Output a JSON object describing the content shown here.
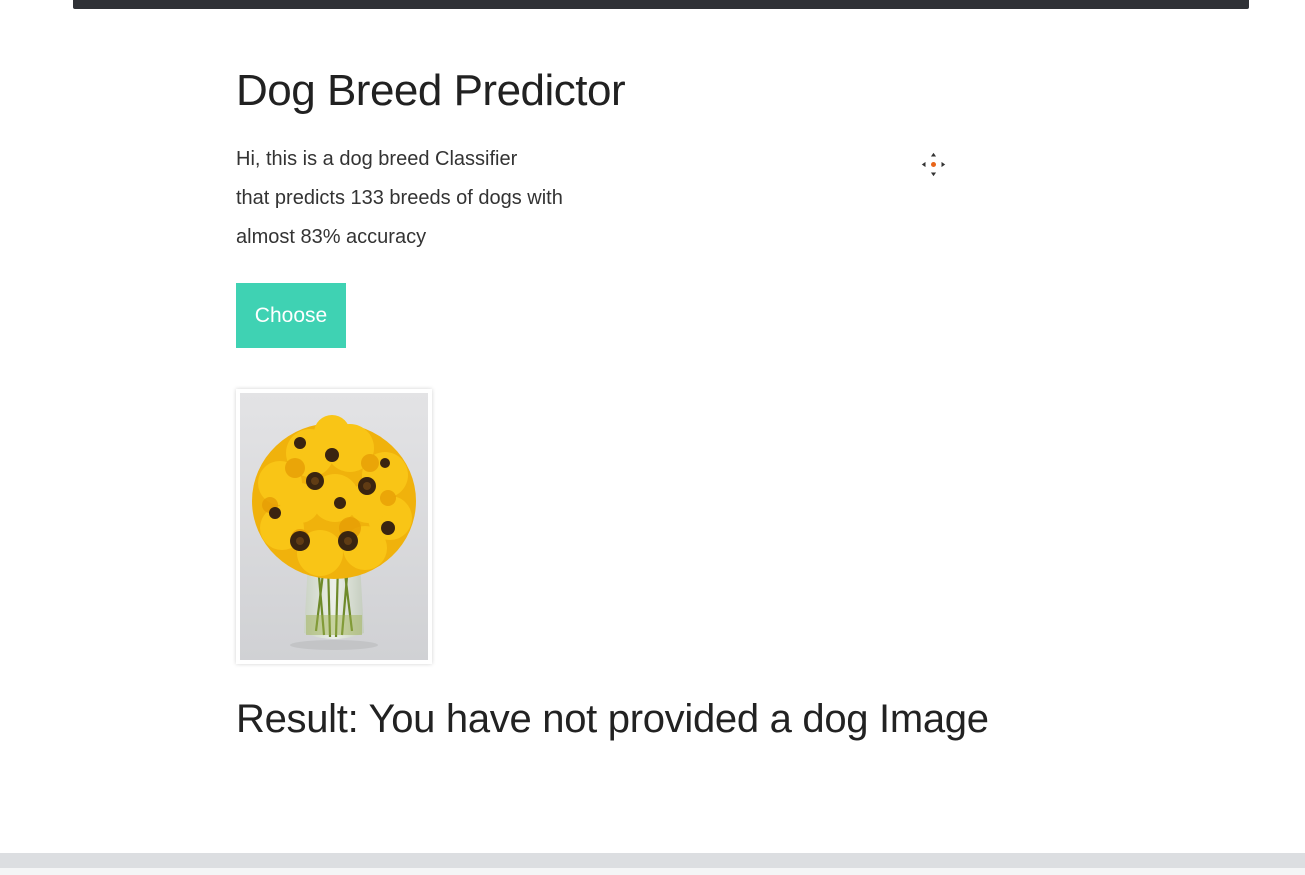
{
  "header": {
    "title": "Dog Breed Predictor"
  },
  "intro": {
    "lines": [
      "Hi, this is a dog breed Classifier",
      "that predicts 133 breeds of dogs with",
      "almost 83% accuracy"
    ]
  },
  "upload": {
    "button_label": "Choose"
  },
  "preview": {
    "image_icon": "sunflower-bouquet-image"
  },
  "result": {
    "text": "Result: You have not provided a dog Image"
  },
  "cursor": {
    "icon": "move-cursor-icon"
  },
  "colors": {
    "accent": "#3fd2b3",
    "top_bar": "#2f3136"
  }
}
